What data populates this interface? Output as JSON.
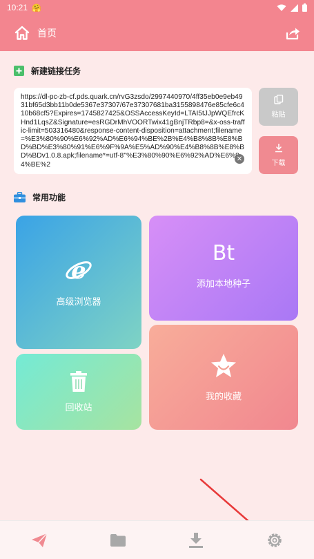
{
  "status_bar": {
    "time": "10:21",
    "emoji": "🤗"
  },
  "header": {
    "title": "首页",
    "home_icon": "home-icon",
    "share_icon": "share-icon"
  },
  "new_task": {
    "title": "新建链接任务",
    "url": "https://dl-pc-zb-cf.pds.quark.cn/rvG3zsdo/2997440970/4ff35eb0e9eb4931bf65d3bb11b0de5367e37307/67e37307681ba3155898476e85cfe6c410b68cf5?Expires=1745827425&OSSAccessKeyId=LTAI5tJJpWQEfrcKHnd1LqsZ&Signature=esRGDrMhVOORTwix41gBnjTRbp8=&x-oss-traffic-limit=503316480&response-content-disposition=attachment;filename=%E3%80%90%E6%92%AD%E6%94%BE%2B%E4%B8%8B%E8%BD%BD%E3%80%91%E6%9F%9A%E5%AD%90%E4%B8%8B%E8%BD%BDv1.0.8.apk;filename*=utf-8''%E3%80%90%E6%92%AD%E6%94%BE%2",
    "paste_label": "粘贴",
    "download_label": "下载"
  },
  "features": {
    "title": "常用功能",
    "browser_label": "高级浏览器",
    "torrent_label": "添加本地种子",
    "torrent_icon_text": "Bt",
    "recycle_label": "回收站",
    "favorites_label": "我的收藏"
  },
  "bottom_nav": [
    "send-icon",
    "folder-icon",
    "download-icon",
    "settings-icon"
  ],
  "colors": {
    "header": "#f3858f",
    "background": "#fdeaea",
    "paste_button": "#c9c9c9",
    "download_button": "#f08a91",
    "browser_gradient": [
      "#3aa3e6",
      "#7fd3c4"
    ],
    "torrent_gradient": [
      "#d78ff7",
      "#a978f5"
    ],
    "recycle_gradient": [
      "#74ead5",
      "#a7e3a0"
    ],
    "favorites_gradient": [
      "#f8ad9a",
      "#f1878f"
    ]
  }
}
